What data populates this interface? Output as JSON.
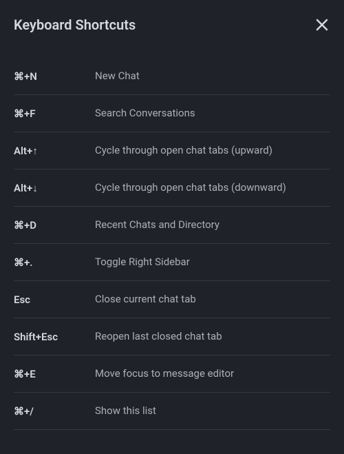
{
  "header": {
    "title": "Keyboard Shortcuts"
  },
  "shortcuts": [
    {
      "key": "⌘+N",
      "desc": "New Chat"
    },
    {
      "key": "⌘+F",
      "desc": "Search Conversations"
    },
    {
      "key": "Alt+↑",
      "desc": "Cycle through open chat tabs (upward)"
    },
    {
      "key": "Alt+↓",
      "desc": "Cycle through open chat tabs (downward)"
    },
    {
      "key": "⌘+D",
      "desc": "Recent Chats and Directory"
    },
    {
      "key": "⌘+.",
      "desc": "Toggle Right Sidebar"
    },
    {
      "key": "Esc",
      "desc": "Close current chat tab"
    },
    {
      "key": "Shift+Esc",
      "desc": "Reopen last closed chat tab"
    },
    {
      "key": "⌘+E",
      "desc": "Move focus to message editor"
    },
    {
      "key": "⌘+/",
      "desc": "Show this list"
    }
  ]
}
